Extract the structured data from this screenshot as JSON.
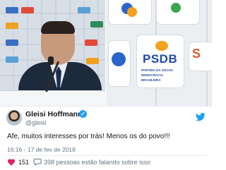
{
  "photo_left": {
    "logo_colors": [
      "#3a6fc4",
      "#e24a3a",
      "#5aa0d6",
      "#2e8b57",
      "#f0a020"
    ]
  },
  "photo_right": {
    "party_label": "PSDB",
    "party_subtitle": "PARTIDO DA SOCIAL DEMOCRACIA BRASILEIRA"
  },
  "tweet": {
    "name": "Gleisi Hoffmann",
    "handle": "@gleisi",
    "text": "Afe, muitos interesses por trás! Menos os do povo!!!",
    "timestamp": "16:16 - 17 de fev de 2018",
    "likes": "151",
    "talking": "398 pessoas estão falando sobre isso",
    "verified_icon": "verified-badge-icon",
    "colors": {
      "brand": "#1da1f2",
      "like": "#e0245e",
      "muted": "#657786"
    }
  }
}
